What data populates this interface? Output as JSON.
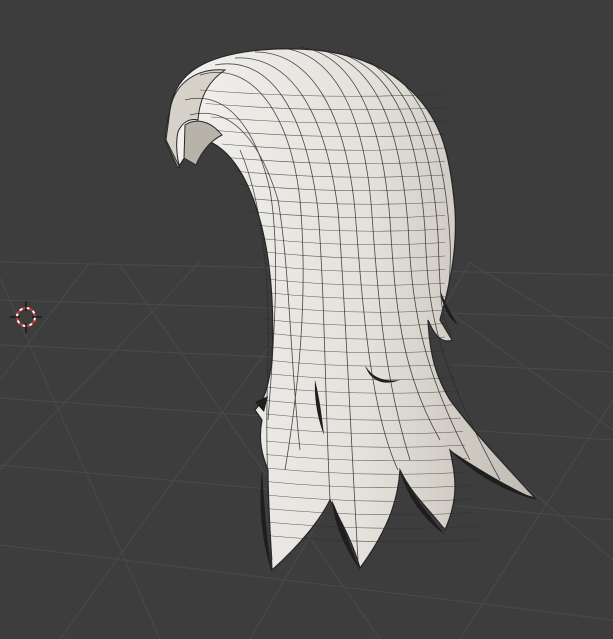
{
  "viewport": {
    "background_color": "#3d3d3d",
    "grid_line_color": "#4a4a4a",
    "mesh_fill_color": "#e8e6e2",
    "mesh_shadow_color": "#c9c5bd",
    "wire_color": "#2b2b2b",
    "cursor_color_red": "#d9302f",
    "cursor_color_white": "#ffffff",
    "object": "hair-mesh",
    "shading_mode": "solid-with-wireframe",
    "cursor_icon": "3d-cursor-icon"
  }
}
